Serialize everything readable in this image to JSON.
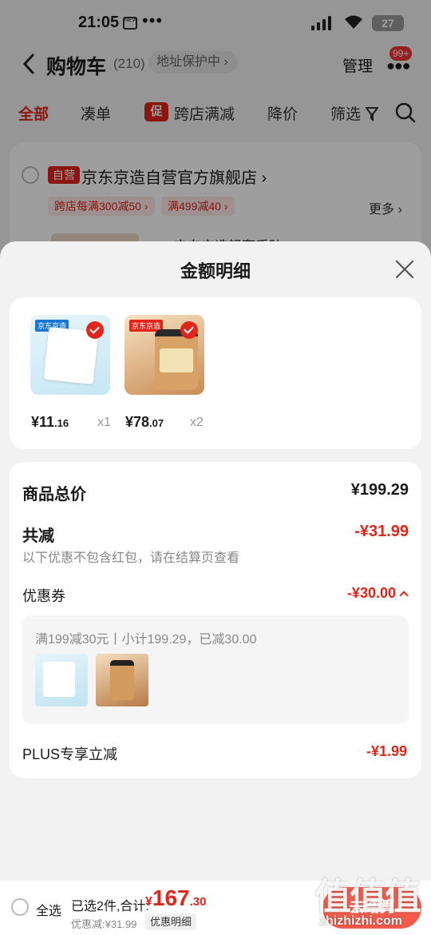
{
  "status_bar": {
    "time": "21:05",
    "battery": "27",
    "mini_icon": "NEW",
    "dots": "•••"
  },
  "header": {
    "title": "购物车",
    "count": "(210)",
    "address": "地址保护中",
    "manage": "管理",
    "badge": "99+"
  },
  "tabs": {
    "all": "全部",
    "bundle": "凑单",
    "promo_badge": "促",
    "cross_store": "跨店满减",
    "price_drop": "降价",
    "filter": "筛选"
  },
  "shop": {
    "tag": "自营",
    "name": "京东京造自营官方旗舰店",
    "coupons": [
      "跨店每满300减50",
      "满499减40"
    ],
    "more": "更多",
    "peek_text": "京东京造轻奢系防..."
  },
  "sheet": {
    "title": "金额明细",
    "items": [
      {
        "label": "京东京造",
        "price_int": "¥11",
        "price_dec": ".16",
        "qty": "x1"
      },
      {
        "label": "京东京造",
        "price_int": "¥78",
        "price_dec": ".07",
        "qty": "x2"
      }
    ],
    "total_label": "商品总价",
    "total_value": "¥199.29",
    "discount_label": "共减",
    "discount_value": "-¥31.99",
    "discount_note": "以下优惠不包含红包，请在结算页查看",
    "coupon_label": "优惠券",
    "coupon_value": "-¥30.00",
    "coupon_detail": "满199减30元丨小计199.29，已减30.00",
    "plus_label": "PLUS专享立减",
    "plus_value": "-¥1.99"
  },
  "bottom_bar": {
    "select_all": "全选",
    "selected_info": "已选2件,合计:",
    "currency": "¥",
    "total_int": "167",
    "total_dec": ".30",
    "discount_info": "优惠减:¥31.99",
    "detail_button": "优惠明细",
    "checkout": "去结算"
  },
  "watermark": {
    "big": "值值值",
    "small": "zhizhizhi.com"
  },
  "colors": {
    "accent": "#e1251b",
    "checkout": "#f35b4c"
  }
}
